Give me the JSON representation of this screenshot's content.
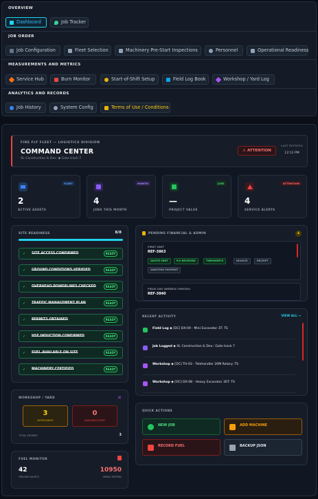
{
  "nav": {
    "sections": [
      {
        "title": "OVERVIEW",
        "buttons": [
          {
            "label": "Dashboard",
            "active": true
          },
          {
            "label": "Job Tracker"
          }
        ]
      },
      {
        "title": "JOB ORDER",
        "buttons": [
          {
            "label": "Job Configuration"
          },
          {
            "label": "Fleet Selection"
          },
          {
            "label": "Machinery Pre-Start Inspections"
          },
          {
            "label": "Personnel"
          },
          {
            "label": "Operational Readiness"
          }
        ]
      },
      {
        "title": "MEASUREMENTS AND METRICS",
        "buttons": [
          {
            "label": "Service Hub"
          },
          {
            "label": "Burn Monitor"
          },
          {
            "label": "Start-of-Shift Setup"
          },
          {
            "label": "Field Log Book"
          },
          {
            "label": "Workshop / Yard Log"
          }
        ]
      },
      {
        "title": "ANALYTICS AND RECORDS",
        "buttons": [
          {
            "label": "Job History"
          },
          {
            "label": "System Config"
          },
          {
            "label": "Terms of Use / Conditions"
          }
        ]
      }
    ]
  },
  "header": {
    "subtitle": "FIRE FLY FLEET — LOGISTICS DIVISION",
    "title": "COMMAND CENTER",
    "location": "XL Construction & Dev. ◆ Gate track 7",
    "attention_label": "⚠ ATTENTION",
    "refresh_label": "LAST REFRESH",
    "refresh_time": "12:12 PM"
  },
  "stats": [
    {
      "tag": "FLEET",
      "value": "2",
      "label": "ACTIVE ASSETS",
      "color": "#3b82f6"
    },
    {
      "tag": "MONTH",
      "value": "4",
      "label": "JOBS THIS MONTH",
      "color": "#8b5cf6"
    },
    {
      "tag": "LIVE",
      "value": "—",
      "label": "PROJECT VALUE",
      "color": "#22c55e"
    },
    {
      "tag": "ATTENTION",
      "value": "4",
      "label": "SERVICE ALERTS",
      "color": "#ef4444"
    }
  ],
  "readiness": {
    "title": "SITE READINESS",
    "count": "8/8",
    "items": [
      "SITE ACCESS CONFIRMED",
      "GROUND CONDITIONS VERIFIED",
      "OVERHEAD POWERLINES CHECKED",
      "TRAFFIC MANAGEMENT PLAN",
      "PERMITS OBTAINED",
      "HSE INDUCTION CONFIRMED",
      "FUEL AVAILABLE ON SITE",
      "MACHINERY CERTIFIED"
    ],
    "status_label": "READY"
  },
  "pending": {
    "title": "PENDING FINANCIAL & ADMIN",
    "badge": "4",
    "card1": {
      "label": "FIRST UNIT",
      "ref": "REF-3863",
      "pills": [
        "QUOTE SENT",
        "P.O RECEIVED",
        "TIMESHEETS",
        "INVOICE",
        "RECEIPT",
        "AWAITING PAYMENT"
      ]
    },
    "card2": {
      "label": "FIELD LOG (WEEKLY CHECKS)",
      "ref": "REF-3840"
    }
  },
  "recent": {
    "title": "RECENT ACTIVITY",
    "link": "VIEW ALL →",
    "items": [
      {
        "bold": "Field Log",
        "text": " ◆ [DC] DX-09 - Mini Excavator 3T: TS",
        "color": "#22c55e"
      },
      {
        "bold": "Job Logged",
        "text": " ◆ XL Construction & Dev.: Gate track 7",
        "color": "#8b5cf6"
      },
      {
        "bold": "Workshop",
        "text": " ◆ [DC] TH-03 - Telehandler 20M Rotary: TS",
        "color": "#a855f7"
      },
      {
        "bold": "Workshop",
        "text": " ◆ [DC] DX-08 - Heavy Excavator 30T: TS",
        "color": "#a855f7"
      }
    ]
  },
  "workshop": {
    "title": "WORKSHOP / YARD",
    "in_progress_value": "3",
    "in_progress_label": "IN PROGRESS",
    "unsigned_value": "0",
    "unsigned_label": "UNSIGNED ENTRY",
    "total_label": "TOTAL ENTRIES",
    "total_value": "3"
  },
  "fuel": {
    "title": "FUEL MONITOR",
    "left_value": "42",
    "left_label": "TRACKED ASSETS",
    "right_value": "10950",
    "right_label": "SERIAL ENTRIES"
  },
  "quick": {
    "title": "QUICK ACTIONS",
    "actions": [
      {
        "label": "NEW JOB",
        "color": "#22c55e"
      },
      {
        "label": "ADD MACHINE",
        "color": "#f59e0b"
      },
      {
        "label": "RECORD FUEL",
        "color": "#ef4444"
      },
      {
        "label": "BACKUP JSON",
        "color": "#9ca3af"
      }
    ]
  }
}
